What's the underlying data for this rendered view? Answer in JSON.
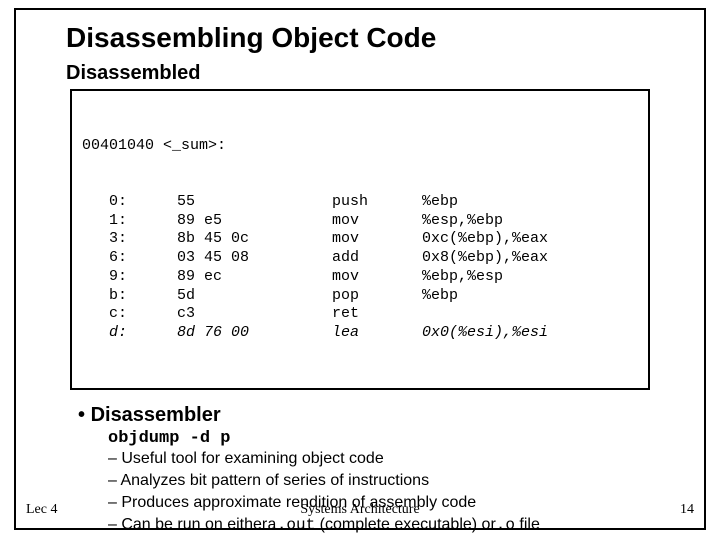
{
  "title": "Disassembling Object Code",
  "subtitle": "Disassembled",
  "code": {
    "header_addr": "00401040",
    "header_rest": " <_sum>:",
    "rows": [
      {
        "addr": "   0:",
        "hex": "55",
        "mn": "push",
        "ops": "%ebp",
        "italic": false
      },
      {
        "addr": "   1:",
        "hex": "89 e5",
        "mn": "mov",
        "ops": "%esp,%ebp",
        "italic": false
      },
      {
        "addr": "   3:",
        "hex": "8b 45 0c",
        "mn": "mov",
        "ops": "0xc(%ebp),%eax",
        "italic": false
      },
      {
        "addr": "   6:",
        "hex": "03 45 08",
        "mn": "add",
        "ops": "0x8(%ebp),%eax",
        "italic": false
      },
      {
        "addr": "   9:",
        "hex": "89 ec",
        "mn": "mov",
        "ops": "%ebp,%esp",
        "italic": false
      },
      {
        "addr": "   b:",
        "hex": "5d",
        "mn": "pop",
        "ops": "%ebp",
        "italic": false
      },
      {
        "addr": "   c:",
        "hex": "c3",
        "mn": "ret",
        "ops": "",
        "italic": false
      },
      {
        "addr": "   d:",
        "hex": "8d 76 00",
        "mn": "lea",
        "ops": "0x0(%esi),%esi",
        "italic": true
      }
    ]
  },
  "bullets": {
    "main": "Disassembler",
    "cmd": "objdump -d p",
    "items": {
      "i0": "Useful tool for examining object code",
      "i1": "Analyzes bit pattern of series of instructions",
      "i2": "Produces approximate rendition of assembly code",
      "i3_pre": "Can be run on either",
      "i3_m1": "a.out",
      "i3_mid": " (complete executable) or",
      "i3_m2": ".o",
      "i3_post": " file"
    }
  },
  "footer": {
    "left": "Lec 4",
    "center": "Systems Architecture",
    "right": "14"
  }
}
